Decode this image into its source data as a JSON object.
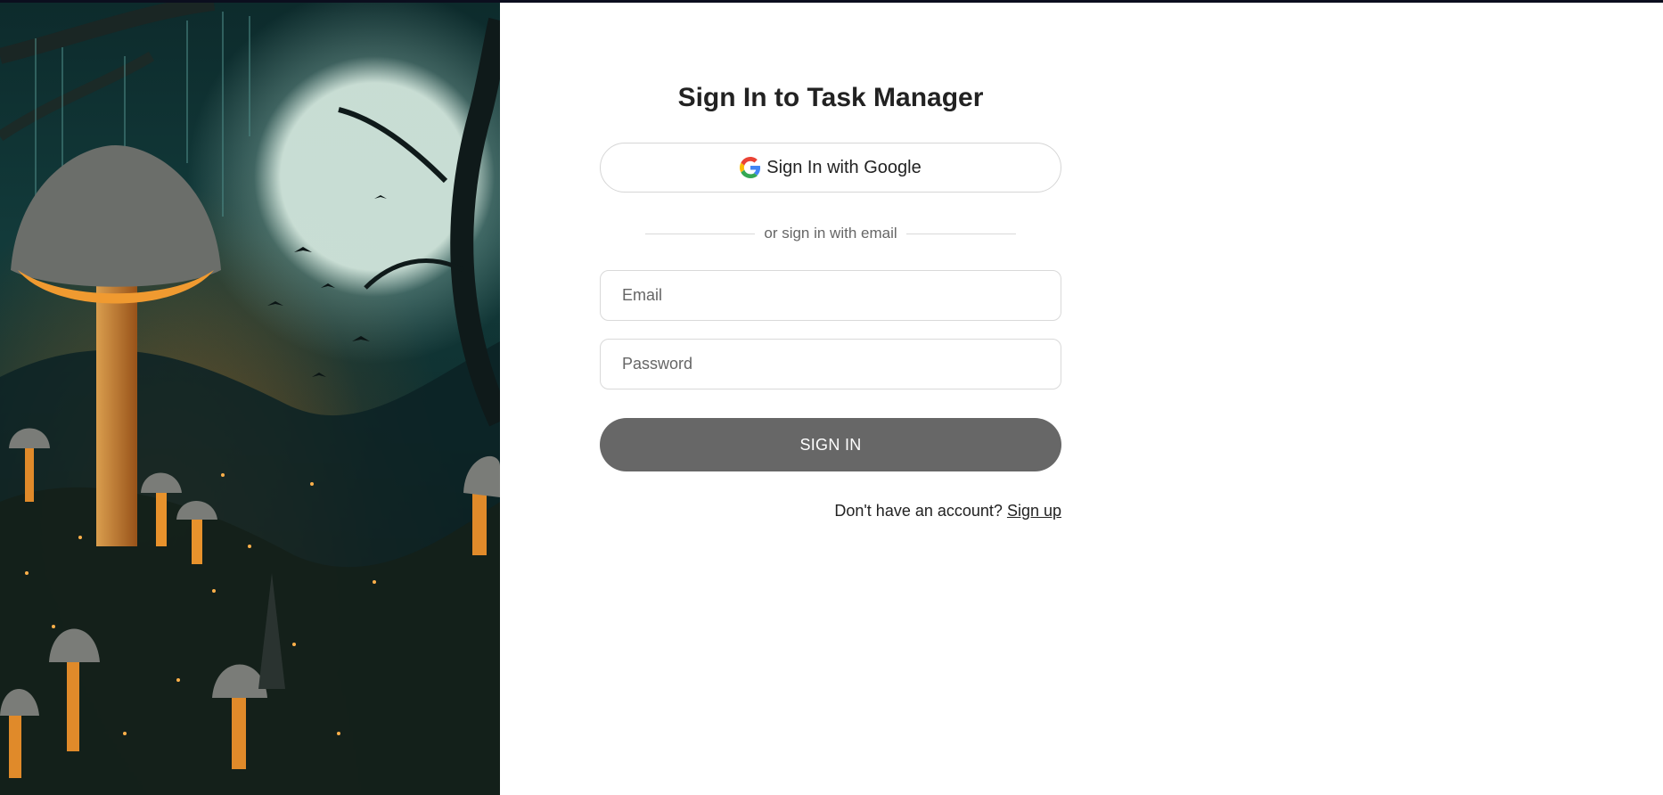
{
  "signin": {
    "title": "Sign In to Task Manager",
    "google_label": "Sign In with Google",
    "divider_text": "or sign in with email",
    "email_placeholder": "Email",
    "password_placeholder": "Password",
    "submit_label": "SIGN IN",
    "signup_prompt": "Don't have an account?",
    "signup_link": "Sign up"
  },
  "icons": {
    "google": "google-logo-icon"
  },
  "colors": {
    "button_gray": "#676767",
    "border": "#d9d9d9",
    "text": "#222222"
  }
}
